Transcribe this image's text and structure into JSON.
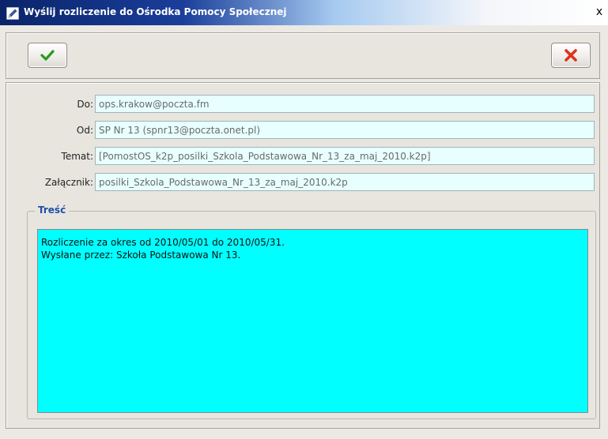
{
  "window": {
    "title": "Wyślij rozliczenie do Ośrodka Pomocy Społecznej",
    "close_glyph": "x",
    "icon": "pencil-edit-icon"
  },
  "toolbar": {
    "ok_icon": "checkmark-icon",
    "ok_color": "#2a9a1e",
    "cancel_icon": "red-x-icon",
    "cancel_color": "#e0301e"
  },
  "form": {
    "to_label": "Do:",
    "to_value": "ops.krakow@poczta.fm",
    "from_label": "Od:",
    "from_value": "SP Nr 13 (spnr13@poczta.onet.pl)",
    "subject_label": "Temat:",
    "subject_value": "[PomostOS_k2p_posilki_Szkola_Podstawowa_Nr_13_za_maj_2010.k2p]",
    "attachment_label": "Załącznik:",
    "attachment_value": "posilki_Szkola_Podstawowa_Nr_13_za_maj_2010.k2p",
    "body_group_title": "Treść",
    "body_line1": "Rozliczenie za okres od 2010/05/01 do 2010/05/31.",
    "body_line2": "Wysłane przez: Szkoła Podstawowa Nr 13."
  },
  "colors": {
    "field_bg": "#e8ffff",
    "body_bg": "#00ffff",
    "legend": "#1f4fa8",
    "title_bar_start": "#0a246a"
  }
}
